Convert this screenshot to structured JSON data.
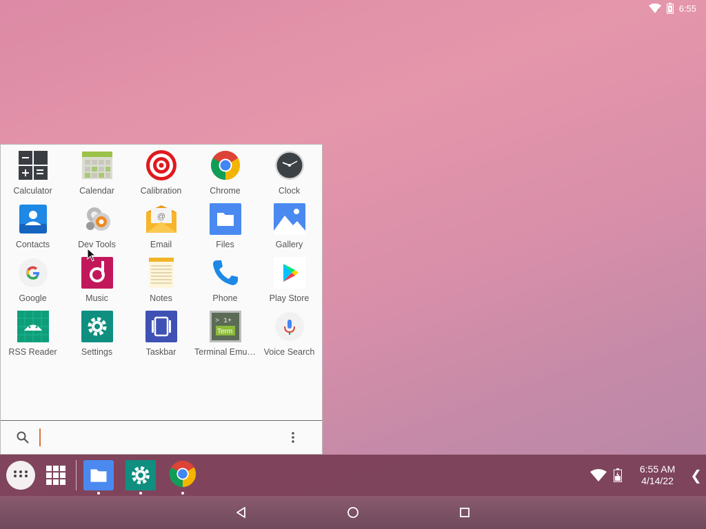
{
  "status_bar": {
    "time": "6:55",
    "icons": [
      "wifi-icon",
      "battery-icon"
    ]
  },
  "launcher": {
    "apps": [
      {
        "label": "Calculator",
        "icon": "calculator-icon"
      },
      {
        "label": "Calendar",
        "icon": "calendar-icon"
      },
      {
        "label": "Calibration",
        "icon": "calibration-icon"
      },
      {
        "label": "Chrome",
        "icon": "chrome-icon"
      },
      {
        "label": "Clock",
        "icon": "clock-icon"
      },
      {
        "label": "Contacts",
        "icon": "contacts-icon"
      },
      {
        "label": "Dev Tools",
        "icon": "dev-tools-icon"
      },
      {
        "label": "Email",
        "icon": "email-icon"
      },
      {
        "label": "Files",
        "icon": "files-icon"
      },
      {
        "label": "Gallery",
        "icon": "gallery-icon"
      },
      {
        "label": "Google",
        "icon": "google-icon"
      },
      {
        "label": "Music",
        "icon": "music-icon"
      },
      {
        "label": "Notes",
        "icon": "notes-icon"
      },
      {
        "label": "Phone",
        "icon": "phone-icon"
      },
      {
        "label": "Play Store",
        "icon": "play-store-icon"
      },
      {
        "label": "RSS Reader",
        "icon": "rss-reader-icon"
      },
      {
        "label": "Settings",
        "icon": "settings-icon"
      },
      {
        "label": "Taskbar",
        "icon": "taskbar-icon"
      },
      {
        "label": "Terminal Emu…",
        "icon": "terminal-icon"
      },
      {
        "label": "Voice Search",
        "icon": "voice-search-icon"
      }
    ],
    "search": {
      "value": "",
      "placeholder": ""
    }
  },
  "taskbar": {
    "pinned": [
      "files-icon",
      "settings-icon",
      "chrome-icon"
    ],
    "clock_time": "6:55 AM",
    "clock_date": "4/14/22"
  },
  "navbar": {
    "buttons": [
      "back",
      "home",
      "recents"
    ]
  }
}
